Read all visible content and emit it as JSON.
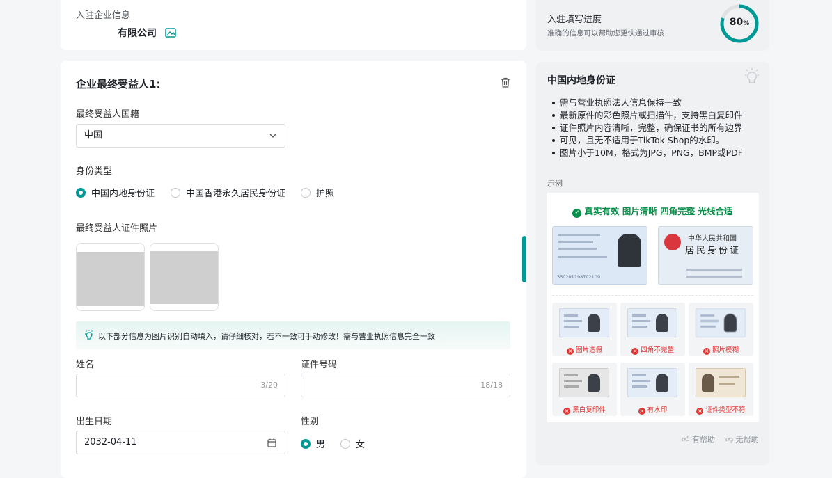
{
  "company_card": {
    "section_label": "入驻企业信息",
    "company_name": "有限公司"
  },
  "beneficiary": {
    "title": "企业最终受益人1:",
    "nationality_label": "最终受益人国籍",
    "nationality_value": "中国",
    "id_type_label": "身份类型",
    "id_types": [
      "中国内地身份证",
      "中国香港永久居民身份证",
      "护照"
    ],
    "id_type_selected": 0,
    "photos_label": "最终受益人证件照片",
    "ocr_notice": "以下部分信息为图片识别自动填入，请仔细核对，若不一致可手动修改！需与营业执照信息完全一致",
    "name_label": "姓名",
    "name_counter": "3/20",
    "id_number_label": "证件号码",
    "id_number_counter": "18/18",
    "birth_label": "出生日期",
    "birth_value": "2032-04-11",
    "gender_label": "性别",
    "genders": [
      "男",
      "女"
    ],
    "gender_selected": 0
  },
  "progress": {
    "title": "入驻填写进度",
    "subtitle": "准确的信息可以帮助您更快通过审核",
    "percent_number": "80",
    "percent_sign": "%",
    "value": 0.8,
    "color": "#009995"
  },
  "help_panel": {
    "title": "中国内地身份证",
    "bullets": [
      "需与营业执照法人信息保持一致",
      "最新原件的彩色照片或扫描件，支持黑白复印件",
      "证件照片内容清晰，完整，确保证书的所有边界",
      "可见，且无不适用于TikTok Shop的水印。",
      "图片小于10M，格式为JPG，PNG，BMP或PDF"
    ],
    "example_label": "示例",
    "good_caption": "真实有效 图片清晰 四角完整 光线合适",
    "id_front_number": "350201198702109",
    "id_back_line1": "中华人民共和国",
    "id_back_line2": "居民身份证",
    "bad_examples": [
      "图片造假",
      "四角不完整",
      "照片模糊",
      "黑白复印件",
      "有水印",
      "证件类型不符"
    ],
    "helpful": "有帮助",
    "not_helpful": "无帮助"
  }
}
